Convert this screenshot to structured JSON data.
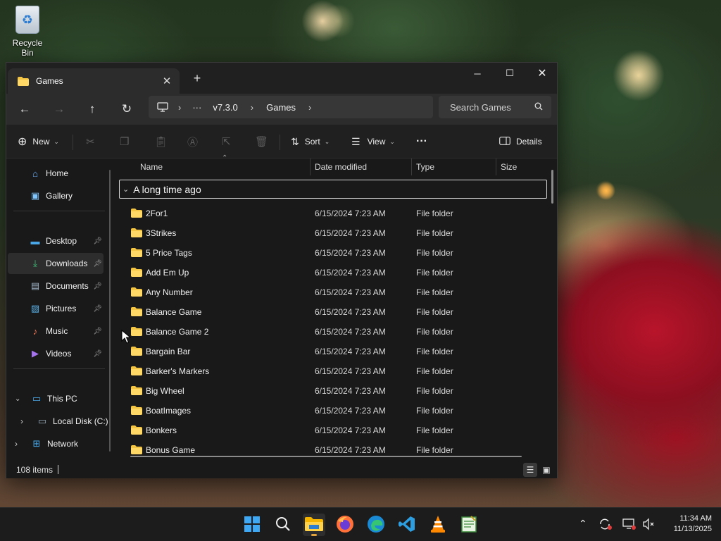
{
  "desktop": {
    "recycle_bin_label": "Recycle Bin"
  },
  "window": {
    "tab_title": "Games",
    "nav": {
      "path": [
        "v7.3.0",
        "Games"
      ],
      "overflow": "···",
      "search_placeholder": "Search Games"
    },
    "command_bar": {
      "new_label": "New",
      "sort_label": "Sort",
      "view_label": "View",
      "more_label": "···",
      "details_label": "Details"
    },
    "sidebar": {
      "home": "Home",
      "gallery": "Gallery",
      "desktop": "Desktop",
      "downloads": "Downloads",
      "documents": "Documents",
      "pictures": "Pictures",
      "music": "Music",
      "videos": "Videos",
      "this_pc": "This PC",
      "local_disk": "Local Disk (C:)",
      "network": "Network"
    },
    "columns": {
      "name": "Name",
      "date_modified": "Date modified",
      "type": "Type",
      "size": "Size"
    },
    "group_label": "A long time ago",
    "files": [
      {
        "name": "2For1",
        "date": "6/15/2024 7:23 AM",
        "type": "File folder"
      },
      {
        "name": "3Strikes",
        "date": "6/15/2024 7:23 AM",
        "type": "File folder"
      },
      {
        "name": "5 Price Tags",
        "date": "6/15/2024 7:23 AM",
        "type": "File folder"
      },
      {
        "name": "Add Em Up",
        "date": "6/15/2024 7:23 AM",
        "type": "File folder"
      },
      {
        "name": "Any Number",
        "date": "6/15/2024 7:23 AM",
        "type": "File folder"
      },
      {
        "name": "Balance Game",
        "date": "6/15/2024 7:23 AM",
        "type": "File folder"
      },
      {
        "name": "Balance Game 2",
        "date": "6/15/2024 7:23 AM",
        "type": "File folder"
      },
      {
        "name": "Bargain Bar",
        "date": "6/15/2024 7:23 AM",
        "type": "File folder"
      },
      {
        "name": "Barker's Markers",
        "date": "6/15/2024 7:23 AM",
        "type": "File folder"
      },
      {
        "name": "Big Wheel",
        "date": "6/15/2024 7:23 AM",
        "type": "File folder"
      },
      {
        "name": "BoatImages",
        "date": "6/15/2024 7:23 AM",
        "type": "File folder"
      },
      {
        "name": "Bonkers",
        "date": "6/15/2024 7:23 AM",
        "type": "File folder"
      },
      {
        "name": "Bonus Game",
        "date": "6/15/2024 7:23 AM",
        "type": "File folder"
      }
    ],
    "status": {
      "item_count": "108 items"
    }
  },
  "taskbar": {
    "apps": [
      "start-icon",
      "search-icon",
      "file-explorer-icon",
      "firefox-icon",
      "edge-icon",
      "vscode-icon",
      "vlc-icon",
      "notepad-icon"
    ],
    "clock_time": "11:34 AM",
    "clock_date": "11/13/2025"
  },
  "colors": {
    "folder": "#f4c542",
    "accent": "#e2a23c",
    "window_bg": "#191919"
  }
}
